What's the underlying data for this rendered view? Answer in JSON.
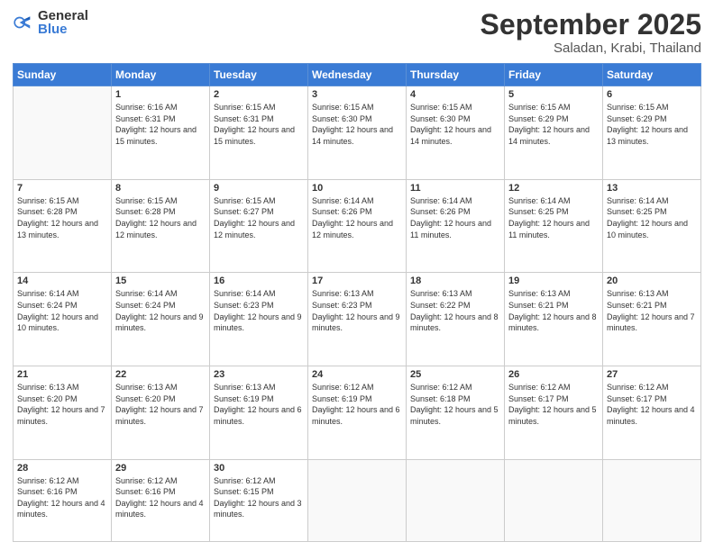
{
  "logo": {
    "general": "General",
    "blue": "Blue"
  },
  "header": {
    "month": "September 2025",
    "location": "Saladan, Krabi, Thailand"
  },
  "weekdays": [
    "Sunday",
    "Monday",
    "Tuesday",
    "Wednesday",
    "Thursday",
    "Friday",
    "Saturday"
  ],
  "weeks": [
    [
      {
        "day": "",
        "sunrise": "",
        "sunset": "",
        "daylight": ""
      },
      {
        "day": "1",
        "sunrise": "6:16 AM",
        "sunset": "6:31 PM",
        "daylight": "12 hours and 15 minutes."
      },
      {
        "day": "2",
        "sunrise": "6:15 AM",
        "sunset": "6:31 PM",
        "daylight": "12 hours and 15 minutes."
      },
      {
        "day": "3",
        "sunrise": "6:15 AM",
        "sunset": "6:30 PM",
        "daylight": "12 hours and 14 minutes."
      },
      {
        "day": "4",
        "sunrise": "6:15 AM",
        "sunset": "6:30 PM",
        "daylight": "12 hours and 14 minutes."
      },
      {
        "day": "5",
        "sunrise": "6:15 AM",
        "sunset": "6:29 PM",
        "daylight": "12 hours and 14 minutes."
      },
      {
        "day": "6",
        "sunrise": "6:15 AM",
        "sunset": "6:29 PM",
        "daylight": "12 hours and 13 minutes."
      }
    ],
    [
      {
        "day": "7",
        "sunrise": "6:15 AM",
        "sunset": "6:28 PM",
        "daylight": "12 hours and 13 minutes."
      },
      {
        "day": "8",
        "sunrise": "6:15 AM",
        "sunset": "6:28 PM",
        "daylight": "12 hours and 12 minutes."
      },
      {
        "day": "9",
        "sunrise": "6:15 AM",
        "sunset": "6:27 PM",
        "daylight": "12 hours and 12 minutes."
      },
      {
        "day": "10",
        "sunrise": "6:14 AM",
        "sunset": "6:26 PM",
        "daylight": "12 hours and 12 minutes."
      },
      {
        "day": "11",
        "sunrise": "6:14 AM",
        "sunset": "6:26 PM",
        "daylight": "12 hours and 11 minutes."
      },
      {
        "day": "12",
        "sunrise": "6:14 AM",
        "sunset": "6:25 PM",
        "daylight": "12 hours and 11 minutes."
      },
      {
        "day": "13",
        "sunrise": "6:14 AM",
        "sunset": "6:25 PM",
        "daylight": "12 hours and 10 minutes."
      }
    ],
    [
      {
        "day": "14",
        "sunrise": "6:14 AM",
        "sunset": "6:24 PM",
        "daylight": "12 hours and 10 minutes."
      },
      {
        "day": "15",
        "sunrise": "6:14 AM",
        "sunset": "6:24 PM",
        "daylight": "12 hours and 9 minutes."
      },
      {
        "day": "16",
        "sunrise": "6:14 AM",
        "sunset": "6:23 PM",
        "daylight": "12 hours and 9 minutes."
      },
      {
        "day": "17",
        "sunrise": "6:13 AM",
        "sunset": "6:23 PM",
        "daylight": "12 hours and 9 minutes."
      },
      {
        "day": "18",
        "sunrise": "6:13 AM",
        "sunset": "6:22 PM",
        "daylight": "12 hours and 8 minutes."
      },
      {
        "day": "19",
        "sunrise": "6:13 AM",
        "sunset": "6:21 PM",
        "daylight": "12 hours and 8 minutes."
      },
      {
        "day": "20",
        "sunrise": "6:13 AM",
        "sunset": "6:21 PM",
        "daylight": "12 hours and 7 minutes."
      }
    ],
    [
      {
        "day": "21",
        "sunrise": "6:13 AM",
        "sunset": "6:20 PM",
        "daylight": "12 hours and 7 minutes."
      },
      {
        "day": "22",
        "sunrise": "6:13 AM",
        "sunset": "6:20 PM",
        "daylight": "12 hours and 7 minutes."
      },
      {
        "day": "23",
        "sunrise": "6:13 AM",
        "sunset": "6:19 PM",
        "daylight": "12 hours and 6 minutes."
      },
      {
        "day": "24",
        "sunrise": "6:12 AM",
        "sunset": "6:19 PM",
        "daylight": "12 hours and 6 minutes."
      },
      {
        "day": "25",
        "sunrise": "6:12 AM",
        "sunset": "6:18 PM",
        "daylight": "12 hours and 5 minutes."
      },
      {
        "day": "26",
        "sunrise": "6:12 AM",
        "sunset": "6:17 PM",
        "daylight": "12 hours and 5 minutes."
      },
      {
        "day": "27",
        "sunrise": "6:12 AM",
        "sunset": "6:17 PM",
        "daylight": "12 hours and 4 minutes."
      }
    ],
    [
      {
        "day": "28",
        "sunrise": "6:12 AM",
        "sunset": "6:16 PM",
        "daylight": "12 hours and 4 minutes."
      },
      {
        "day": "29",
        "sunrise": "6:12 AM",
        "sunset": "6:16 PM",
        "daylight": "12 hours and 4 minutes."
      },
      {
        "day": "30",
        "sunrise": "6:12 AM",
        "sunset": "6:15 PM",
        "daylight": "12 hours and 3 minutes."
      },
      {
        "day": "",
        "sunrise": "",
        "sunset": "",
        "daylight": ""
      },
      {
        "day": "",
        "sunrise": "",
        "sunset": "",
        "daylight": ""
      },
      {
        "day": "",
        "sunrise": "",
        "sunset": "",
        "daylight": ""
      },
      {
        "day": "",
        "sunrise": "",
        "sunset": "",
        "daylight": ""
      }
    ]
  ]
}
